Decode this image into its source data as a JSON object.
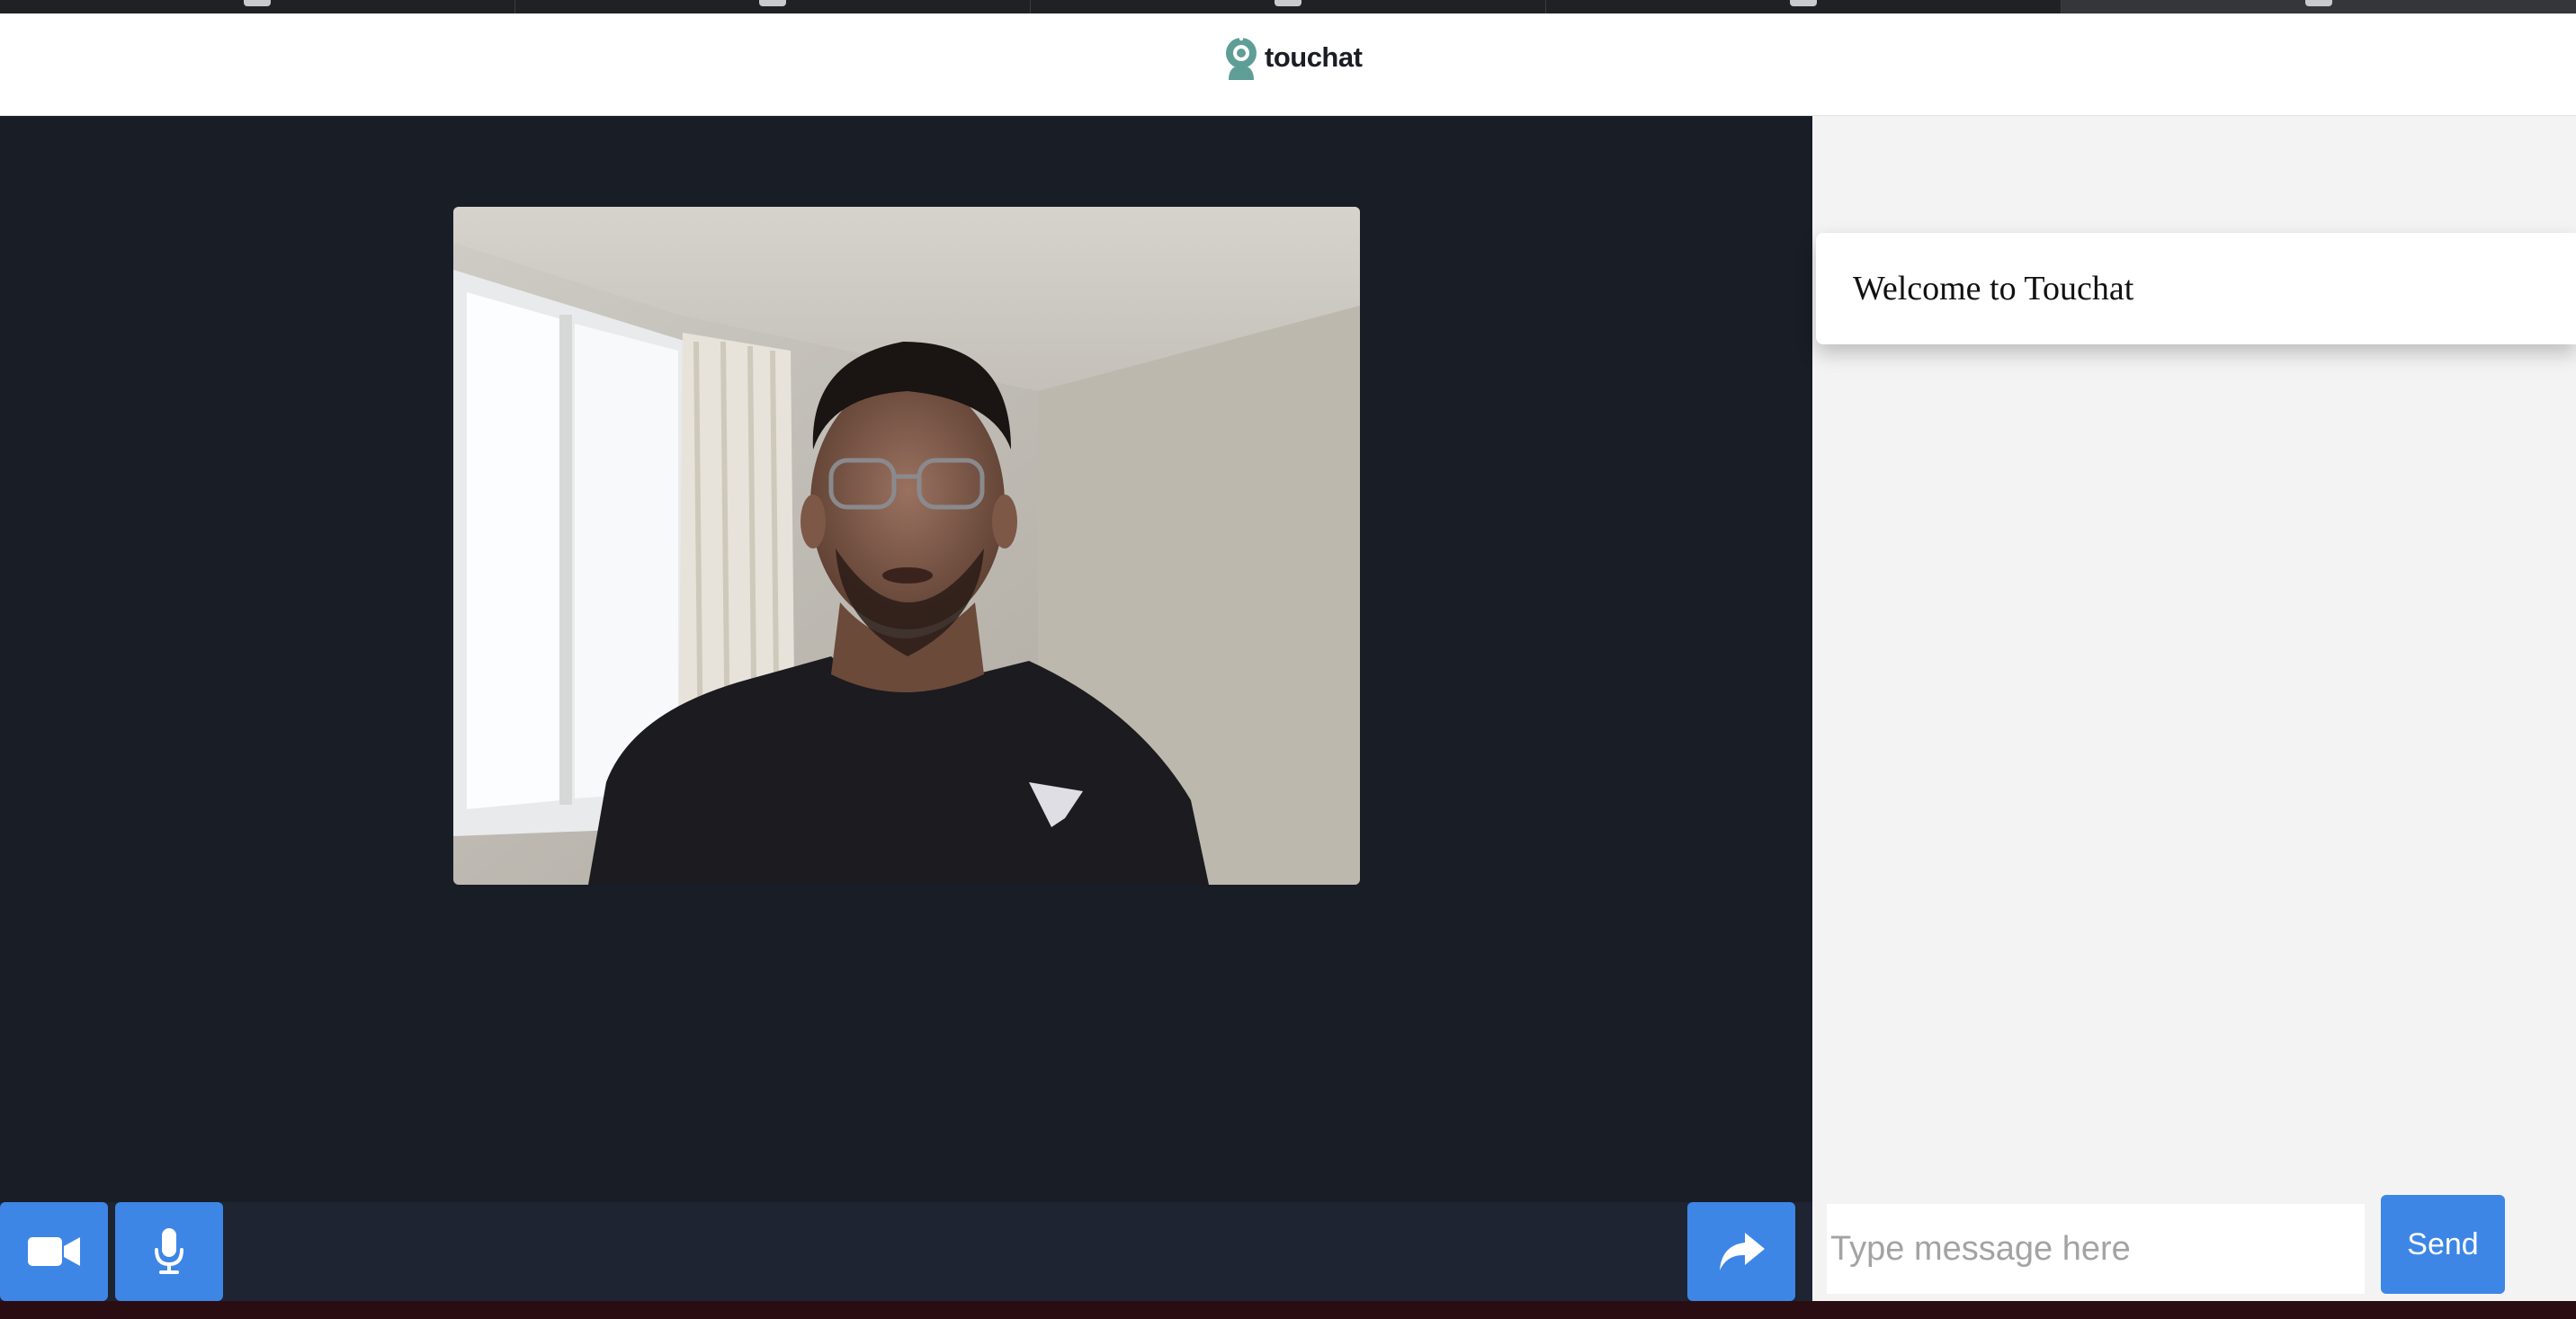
{
  "browser": {
    "tab_count": 5,
    "active_tab_index": 4
  },
  "header": {
    "logo_text": "touchat",
    "logo_icon": "webcam-icon",
    "brand_color": "#5e9e96"
  },
  "video": {
    "feed_description_icon": "camera-feed"
  },
  "controls": {
    "camera_icon": "video-camera-icon",
    "mic_icon": "microphone-icon",
    "share_icon": "share-arrow-icon",
    "button_color": "#3d86e6"
  },
  "chat": {
    "welcome_message": "Welcome to Touchat",
    "input_placeholder": "Type message here",
    "input_value": "",
    "send_label": "Send"
  }
}
